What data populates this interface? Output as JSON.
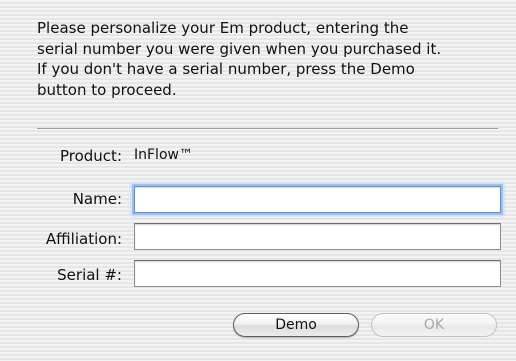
{
  "dialog": {
    "message": "Please personalize your Em product, entering the\nserial number you were given when you purchased it.\nIf you don't have a serial number, press the Demo\nbutton to proceed."
  },
  "form": {
    "product_label": "Product:",
    "product_value": "InFlow™",
    "name_label": "Name:",
    "name_value": "",
    "affiliation_label": "Affiliation:",
    "affiliation_value": "",
    "serial_label": "Serial #:",
    "serial_value": ""
  },
  "buttons": {
    "demo_label": "Demo",
    "ok_label": "OK"
  },
  "colors": {
    "focus_ring": "#9ec2ef",
    "disabled_text": "#a8a8a8"
  }
}
